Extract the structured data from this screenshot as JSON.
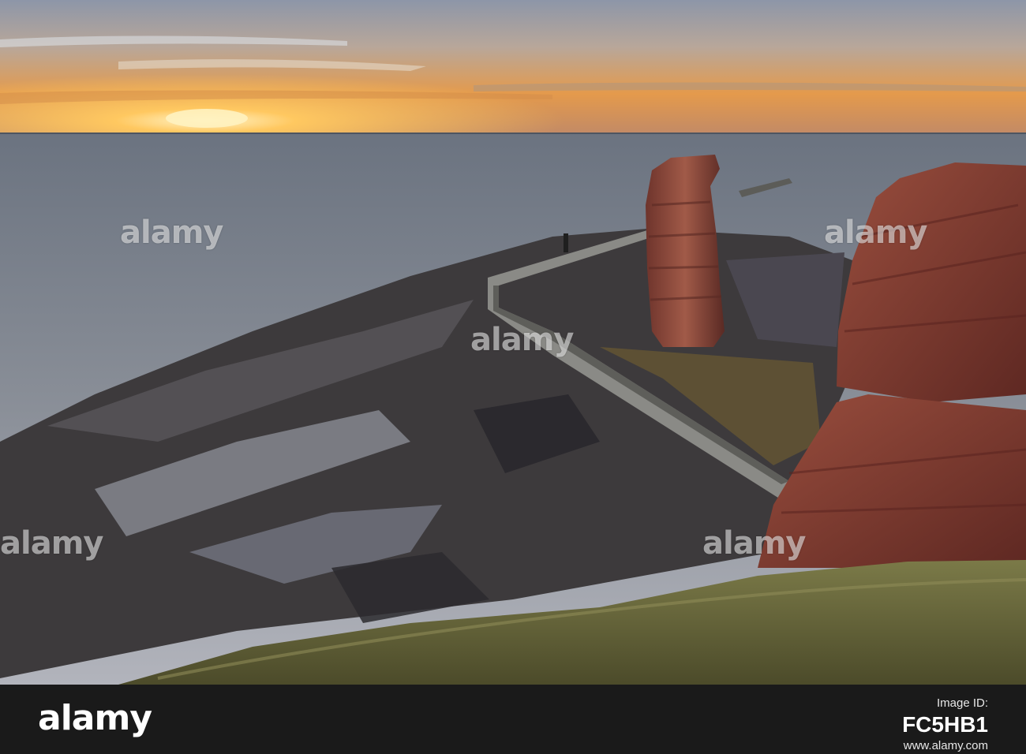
{
  "photo": {
    "subject": "sunset over the sea with red sandstone sea stack, harbour wall and tidal rock flats",
    "sky_colors": [
      "#f2a13a",
      "#c9917a",
      "#9aa0b2"
    ],
    "sea_color": "#5f6875",
    "rock_color": "#7a3a30",
    "grass_color": "#6a6a3a"
  },
  "watermark": {
    "text": "alamy"
  },
  "footer": {
    "logo": "alamy",
    "image_id_label": "Image ID:",
    "image_id": "FC5HB1",
    "site": "www.alamy.com"
  }
}
